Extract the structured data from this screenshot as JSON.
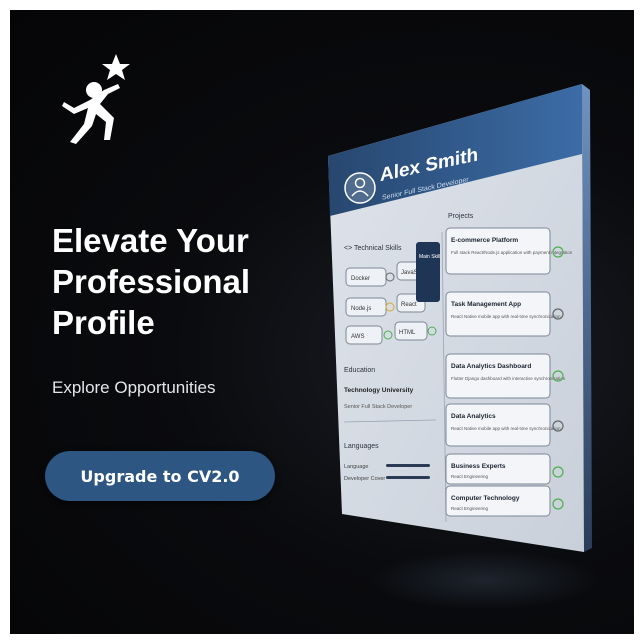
{
  "headline": {
    "line1": "Elevate Your",
    "line2": "Professional",
    "line3": "Profile"
  },
  "subheadline": "Explore Opportunities",
  "cta_label": "Upgrade to CV2.0",
  "profile_card": {
    "name": "Alex Smith",
    "role": "Senior Full Stack Developer",
    "sections": {
      "skills_title": "<> Technical Skills",
      "projects_title": "Projects",
      "education_title": "Education",
      "languages_title": "Languages"
    },
    "skills": [
      "Docker",
      "JavaScript",
      "Node.js",
      "React",
      "AWS",
      "HTML"
    ],
    "skill_tooltip": "Main Skill",
    "education": {
      "school": "Technology University",
      "line": "Senior Full Stack Developer"
    },
    "languages": [
      "Language",
      "Developer Cover"
    ],
    "projects": [
      {
        "title": "E-commerce Platform",
        "desc": "Full stack React/Node.js application with payment integration"
      },
      {
        "title": "Task Management App",
        "desc": "React Native mobile app with real-time synchronization"
      },
      {
        "title": "Data Analytics Dashboard",
        "desc": "Flutter Django dashboard with interactive synchronization"
      },
      {
        "title": "Data Analytics",
        "desc": "React Native mobile app with real-time synchronization"
      },
      {
        "title": "Business Experts",
        "desc": "React Engineering"
      },
      {
        "title": "Computer Technology",
        "desc": "React Engineering"
      }
    ]
  },
  "colors": {
    "background": "#0a0b0e",
    "cta": "#2e5683",
    "card_header": "#2f5a8e",
    "card_body": "#e7ebf0",
    "check": "#4caf50"
  },
  "icons": {
    "logo": "rising-person-star-icon",
    "avatar": "user-icon",
    "check": "check-circle-icon",
    "cross": "cross-circle-icon"
  }
}
